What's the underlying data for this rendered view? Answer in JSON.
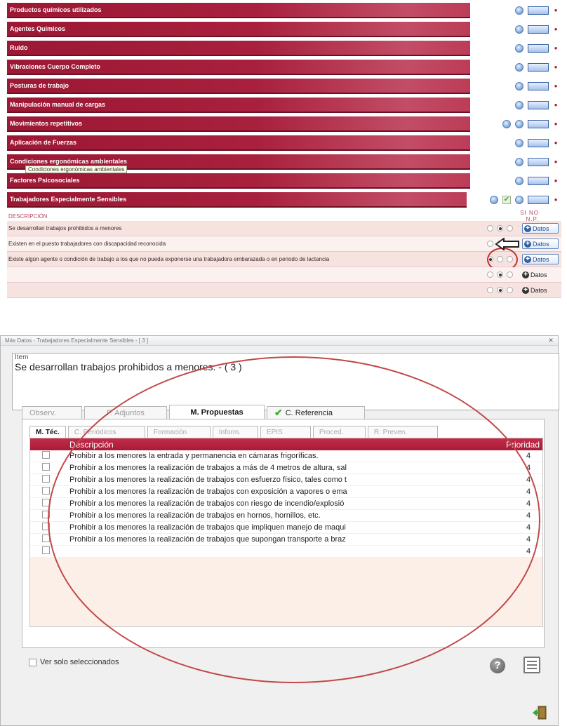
{
  "top_panel": {
    "sections": [
      {
        "title": "Productos químicos utilizados"
      },
      {
        "title": "Agentes Químicos"
      },
      {
        "title": "Ruido"
      },
      {
        "title": "Vibraciones Cuerpo Completo"
      },
      {
        "title": "Posturas de trabajo"
      },
      {
        "title": "Manipulación manual de cargas"
      },
      {
        "title": "Movimientos repetitivos"
      },
      {
        "title": "Aplicación de Fuerzas"
      },
      {
        "title": "Condiciones ergonómicas ambientales"
      },
      {
        "title": "Factores Psicosociales"
      },
      {
        "title": "Trabajadores Especialmente Sensibles"
      }
    ],
    "tooltip": "Condiciones ergonómicas ambientales",
    "desc_header": "DESCRIPCIÓN",
    "answer_cols": "SI NO N.P.",
    "questions": [
      {
        "text": "Se desarrollan trabajos prohibidos a menores",
        "datos": "Datos",
        "selected": 1
      },
      {
        "text": "Existen en el puesto trabajadores con discapacidad reconocida",
        "datos": "Datos",
        "selected": -1
      },
      {
        "text": "Existe algún agente o condición de trabajo a los que no pueda exponerse una trabajadora embarazada o en periodo de lactancia",
        "datos": "Datos",
        "selected": 0
      },
      {
        "text": "",
        "datos": "Datos",
        "selected": 1
      },
      {
        "text": "",
        "datos": "Datos",
        "selected": 1
      }
    ]
  },
  "dialog": {
    "title": "Más Datos - Trabajadores Especialmente Sensibles - [ 3 ]",
    "item_label": "Item",
    "item_value": "Se desarrollan trabajos prohibidos a menores. - ( 3 )",
    "tabs": [
      "Observ.",
      "F. Adjuntos",
      "M. Propuestas",
      "C. Referencia"
    ],
    "subtabs": [
      "M. Téc.",
      "C. Periódicos",
      "Formación",
      "Inform.",
      "EPIS",
      "Proced.",
      "R. Preven."
    ],
    "grid": {
      "col_desc": "Descripción",
      "col_prio": "Prioridad",
      "rows": [
        {
          "desc": "Prohibir a los menores la entrada y permanencia en cámaras frigoríficas.",
          "prio": "4"
        },
        {
          "desc": "Prohibir a los menores la realización de trabajos a más de 4 metros de altura, sal",
          "prio": "4"
        },
        {
          "desc": "Prohibir a los menores la realización de trabajos con esfuerzo físico, tales como t",
          "prio": "4"
        },
        {
          "desc": "Prohibir a los menores la realización de trabajos con exposición a vapores o ema",
          "prio": "4"
        },
        {
          "desc": "Prohibir a los menores la realización de trabajos con riesgo de incendio/explosió",
          "prio": "4"
        },
        {
          "desc": "Prohibir a los menores la realización de trabajos en hornos, hornillos, etc.",
          "prio": "4"
        },
        {
          "desc": "Prohibir a los menores la realización de trabajos que impliquen manejo de maqui",
          "prio": "4"
        },
        {
          "desc": "Prohibir a los menores la realización de trabajos que supongan transporte a braz",
          "prio": "4"
        },
        {
          "desc": "",
          "prio": "4"
        }
      ]
    },
    "ver_solo": "Ver solo seleccionados"
  }
}
